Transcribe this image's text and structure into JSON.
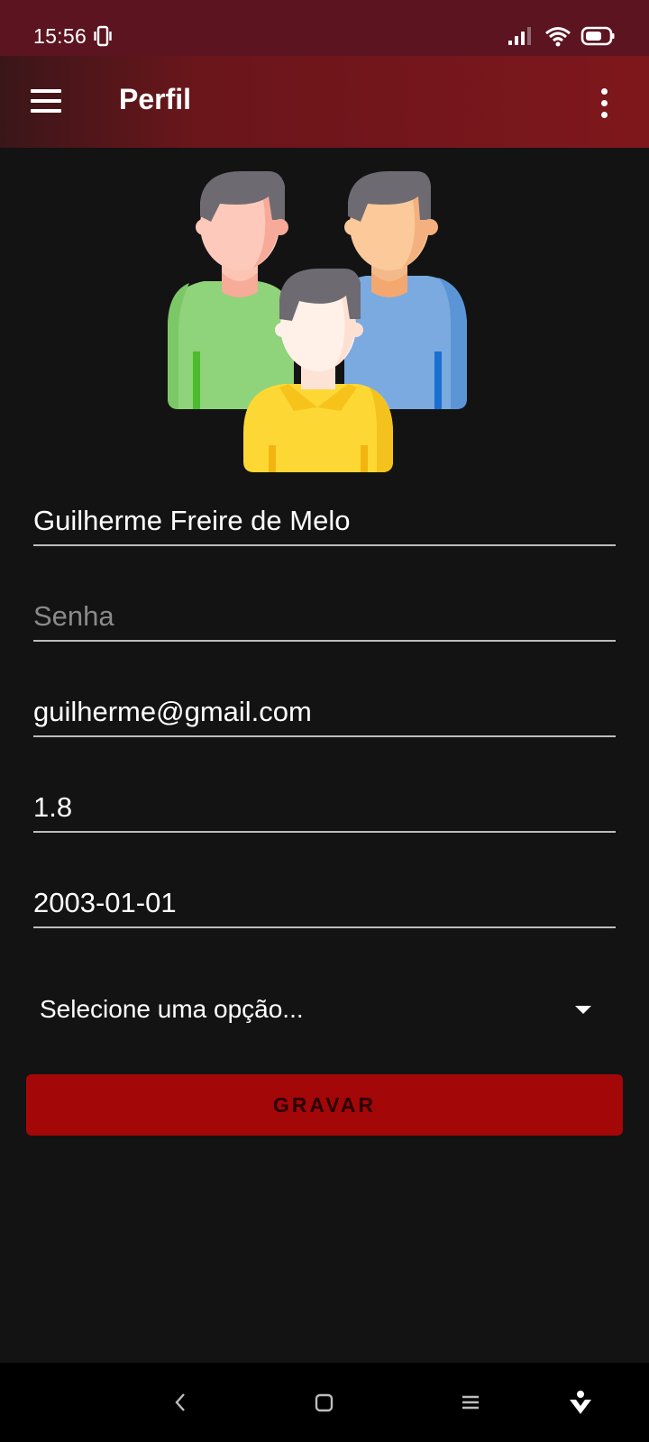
{
  "status_bar": {
    "time": "15:56",
    "icons": [
      "vibrate-icon",
      "signal-icon",
      "wifi-icon",
      "battery-icon"
    ]
  },
  "app_bar": {
    "title": "Perfil",
    "menu_icon": "menu-icon",
    "more_icon": "more-vert-icon"
  },
  "avatar": {
    "icon": "group-people-icon"
  },
  "form": {
    "name_value": "Guilherme Freire de Melo",
    "password_placeholder": "Senha",
    "email_value": "guilherme@gmail.com",
    "height_value": "1.8",
    "birthdate_value": "2003-01-01",
    "select_value": "Selecione uma opção...",
    "save_label": "GRAVAR"
  },
  "nav_bar": {
    "icons": [
      "back-icon",
      "home-icon",
      "recents-icon",
      "assistant-icon"
    ]
  },
  "colors": {
    "status_bar": "#5c1420",
    "app_bar": "#7e171c",
    "background": "#131313",
    "button": "#a30707"
  }
}
